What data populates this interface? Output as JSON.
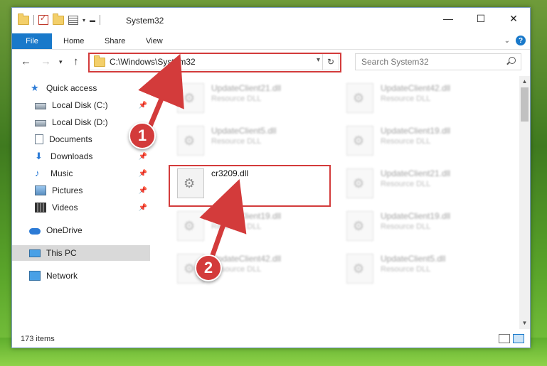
{
  "window": {
    "title": "System32"
  },
  "controls": {
    "minimize": "—",
    "maximize": "☐",
    "close": "✕"
  },
  "ribbon": {
    "tabs": [
      "File",
      "Home",
      "Share",
      "View"
    ]
  },
  "navigation": {
    "address": "C:\\Windows\\System32",
    "search_placeholder": "Search System32"
  },
  "sidebar": {
    "items": [
      {
        "label": "Quick access",
        "icon": "star-icon"
      },
      {
        "label": "Local Disk (C:)",
        "icon": "drive-icon"
      },
      {
        "label": "Local Disk (D:)",
        "icon": "drive-icon"
      },
      {
        "label": "Documents",
        "icon": "documents-icon"
      },
      {
        "label": "Downloads",
        "icon": "download-icon"
      },
      {
        "label": "Music",
        "icon": "music-icon"
      },
      {
        "label": "Pictures",
        "icon": "pictures-icon"
      },
      {
        "label": "Videos",
        "icon": "videos-icon"
      },
      {
        "label": "OneDrive",
        "icon": "cloud-icon"
      },
      {
        "label": "This PC",
        "icon": "computer-icon"
      },
      {
        "label": "Network",
        "icon": "network-icon"
      }
    ],
    "selected": "This PC"
  },
  "files": [
    {
      "name": "UpdateClient21.dll",
      "type": "Resource DLL"
    },
    {
      "name": "UpdateClient42.dll",
      "type": "Resource DLL"
    },
    {
      "name": "UpdateClient5.dll",
      "type": "Resource DLL"
    },
    {
      "name": "UpdateClient19.dll",
      "type": "Resource DLL"
    },
    {
      "name": "cr3209.dll",
      "type": ""
    },
    {
      "name": "UpdateClient21.dll",
      "type": "Resource DLL"
    },
    {
      "name": "UpdateClient19.dll",
      "type": "Resource DLL"
    },
    {
      "name": "UpdateClient19.dll",
      "type": "Resource DLL"
    },
    {
      "name": "UpdateClient42.dll",
      "type": "Resource DLL"
    },
    {
      "name": "UpdateClient5.dll",
      "type": "Resource DLL"
    }
  ],
  "status": {
    "item_count": "173 items"
  },
  "callouts": {
    "one": "1",
    "two": "2"
  },
  "colors": {
    "accent": "#1979ca",
    "highlight": "#d33b3b"
  }
}
